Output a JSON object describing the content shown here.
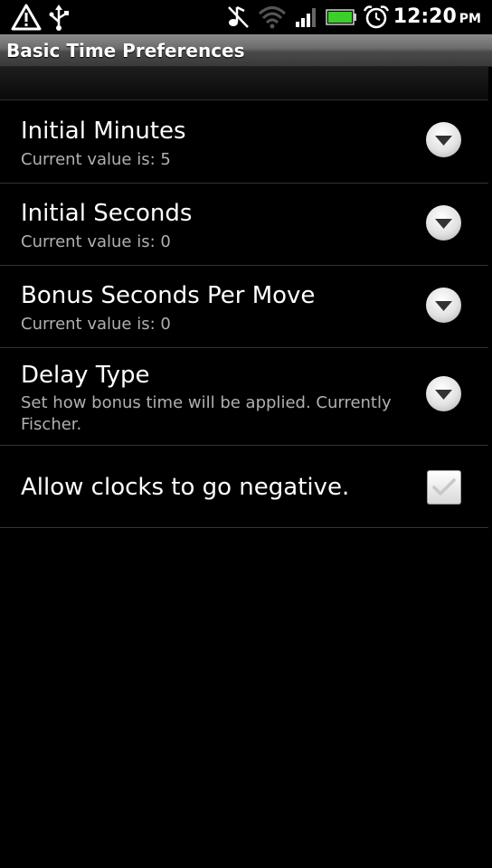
{
  "status_bar": {
    "time": "12:20",
    "ampm": "PM",
    "icons": [
      "warning-icon",
      "usb-icon",
      "no-music-icon",
      "wifi-icon",
      "signal-icon",
      "battery-icon",
      "alarm-icon"
    ]
  },
  "app": {
    "title": "Basic Time Preferences"
  },
  "preferences": [
    {
      "title": "Initial Minutes",
      "summary": "Current value is: 5",
      "control": "dropdown"
    },
    {
      "title": "Initial Seconds",
      "summary": "Current value is: 0",
      "control": "dropdown"
    },
    {
      "title": "Bonus Seconds Per Move",
      "summary": "Current value is: 0",
      "control": "dropdown"
    },
    {
      "title": "Delay Type",
      "summary": "Set how bonus time will be applied. Currently Fischer.",
      "control": "dropdown"
    },
    {
      "title": "Allow clocks to go negative.",
      "control": "checkbox",
      "checked": true
    }
  ],
  "colors": {
    "background": "#000000",
    "battery": "#3ccf29",
    "summary_text": "#b0b0b0"
  }
}
